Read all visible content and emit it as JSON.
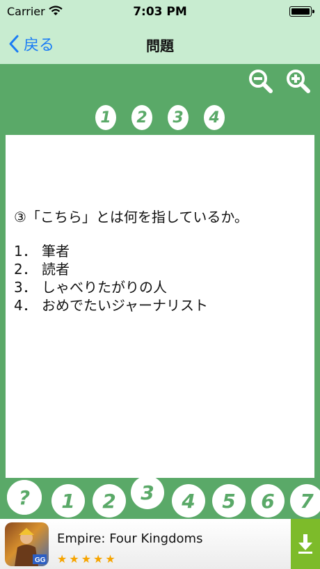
{
  "status": {
    "carrier": "Carrier",
    "time": "7:03 PM"
  },
  "nav": {
    "back_label": "戻る",
    "title": "問題"
  },
  "zoom": {
    "out_icon": "zoom-out-icon",
    "in_icon": "zoom-in-icon"
  },
  "question_tabs": [
    "1",
    "2",
    "3",
    "4"
  ],
  "question": {
    "text": "③「こちら」とは何を指しているか。",
    "options": [
      {
        "num": "1．",
        "text": "筆者"
      },
      {
        "num": "2．",
        "text": "読者"
      },
      {
        "num": "3．",
        "text": "しゃべりたがりの人"
      },
      {
        "num": "4．",
        "text": "おめでたいジャーナリスト"
      }
    ]
  },
  "bottom_nav": {
    "help": "?",
    "items": [
      "1",
      "2",
      "3",
      "4",
      "5",
      "6",
      "7"
    ],
    "selected": "3"
  },
  "ad": {
    "title": "Empire: Four Kingdoms",
    "rating": 5,
    "stars": "★★★★★",
    "badge": "GG"
  },
  "colors": {
    "green": "#5aa968",
    "header": "#c8ecd0",
    "link": "#1a7cf5",
    "download": "#7dbb2a",
    "star": "#f6a400"
  }
}
